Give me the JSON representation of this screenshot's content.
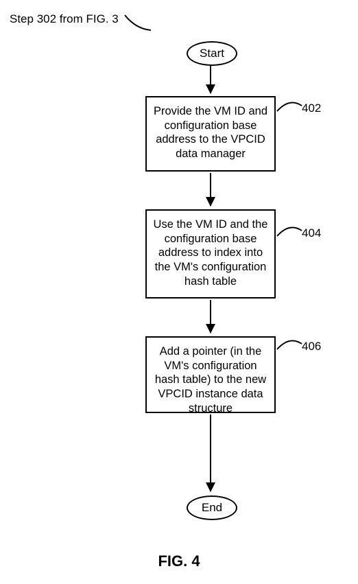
{
  "reference_label": "Step 302 from FIG. 3",
  "terminators": {
    "start": "Start",
    "end": "End"
  },
  "steps": [
    {
      "id": "402",
      "text": "Provide the VM ID and configuration base address to the VPCID data manager"
    },
    {
      "id": "404",
      "text": "Use the VM ID and the configuration base address to index into the VM's configuration hash table"
    },
    {
      "id": "406",
      "text": "Add a pointer (in the VM's configuration hash table) to the new VPCID instance data structure"
    }
  ],
  "figure_caption": "FIG. 4",
  "chart_data": {
    "type": "flowchart",
    "title": "FIG. 4",
    "reference": "Step 302 from FIG. 3",
    "nodes": [
      {
        "id": "start",
        "type": "terminator",
        "label": "Start"
      },
      {
        "id": "402",
        "type": "process",
        "label": "Provide the VM ID and configuration base address to the VPCID data manager"
      },
      {
        "id": "404",
        "type": "process",
        "label": "Use the VM ID and the configuration base address to index into the VM's configuration hash table"
      },
      {
        "id": "406",
        "type": "process",
        "label": "Add a pointer (in the VM's configuration hash table) to the new VPCID instance data structure"
      },
      {
        "id": "end",
        "type": "terminator",
        "label": "End"
      }
    ],
    "edges": [
      {
        "from": "start",
        "to": "402"
      },
      {
        "from": "402",
        "to": "404"
      },
      {
        "from": "404",
        "to": "406"
      },
      {
        "from": "406",
        "to": "end"
      }
    ]
  }
}
